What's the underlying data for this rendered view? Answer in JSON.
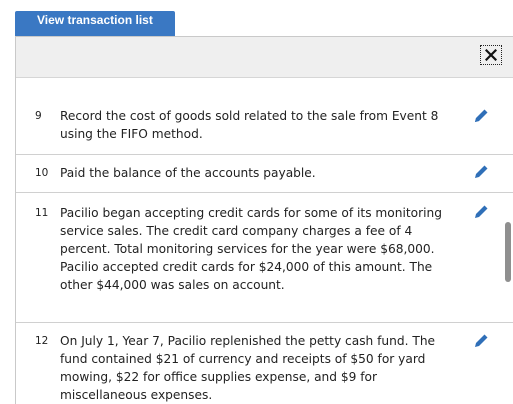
{
  "tab": {
    "label": "View transaction list"
  },
  "header": {
    "close_icon": "close-icon"
  },
  "rows": [
    {
      "num": "9",
      "text": "Record the cost of goods sold related to the sale from Event 8 using the FIFO method.",
      "edit_icon": "pencil-icon"
    },
    {
      "num": "10",
      "text": "Paid the balance of the accounts payable.",
      "edit_icon": "pencil-icon"
    },
    {
      "num": "11",
      "text": "Pacilio began accepting credit cards for some of its monitoring service sales. The credit card company charges a fee of 4 percent. Total monitoring services for the year were $68,000. Pacilio accepted credit cards for $24,000 of this amount. The other $44,000 was sales on account.",
      "edit_icon": "pencil-icon"
    },
    {
      "num": "12",
      "text": "On July 1, Year 7, Pacilio replenished the petty cash fund. The fund contained $21 of currency and receipts of $50 for yard mowing, $22 for office supplies expense, and $9 for miscellaneous expenses.",
      "edit_icon": "pencil-icon"
    }
  ],
  "colors": {
    "accent": "#3a78c3",
    "edit_icon": "#2f6fb8",
    "header_bg": "#efefef"
  }
}
